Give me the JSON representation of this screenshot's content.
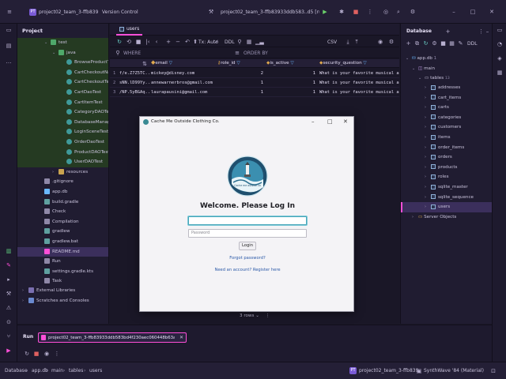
{
  "titlebar": {
    "project_badge": "PT",
    "project_name": "project02_team_3-ffb839",
    "vcs": "Version Control",
    "run_config": "project02_team_3-ffb83933ddb583..d5 [run]"
  },
  "project_panel": {
    "title": "Project",
    "items": [
      {
        "label": "test",
        "indent": 0
      },
      {
        "label": "java",
        "indent": 1
      },
      {
        "label": "BrowseProductTest",
        "indent": 2
      },
      {
        "label": "CartCheckoutNavi",
        "indent": 2
      },
      {
        "label": "CartCheckoutTest",
        "indent": 2
      },
      {
        "label": "CartDaoTest",
        "indent": 2
      },
      {
        "label": "CartItemTest",
        "indent": 2
      },
      {
        "label": "CategoryDAOTest",
        "indent": 2
      },
      {
        "label": "DatabaseManager",
        "indent": 2
      },
      {
        "label": "LoginSceneTest",
        "indent": 2
      },
      {
        "label": "OrderDaoTest",
        "indent": 2
      },
      {
        "label": "ProductDAOTest",
        "indent": 2
      },
      {
        "label": "UserDAOTest",
        "indent": 2
      },
      {
        "label": "resources",
        "indent": 1
      },
      {
        "label": ".gitignore",
        "indent": -1
      },
      {
        "label": "app.db",
        "indent": -1
      },
      {
        "label": "build.gradle",
        "indent": -1
      },
      {
        "label": "Check",
        "indent": -1
      },
      {
        "label": "Compilation",
        "indent": -1
      },
      {
        "label": "gradlew",
        "indent": -1
      },
      {
        "label": "gradlew.bat",
        "indent": -1
      },
      {
        "label": "README.md",
        "indent": -1
      },
      {
        "label": "Run",
        "indent": -1
      },
      {
        "label": "settings.gradle.kts",
        "indent": -1
      },
      {
        "label": "Task",
        "indent": -1
      }
    ],
    "external": "External Libraries",
    "scratches": "Scratches and Consoles"
  },
  "editor": {
    "tab": "users",
    "toolbar": {
      "tx": "Tx: Auto",
      "ddl": "DDL",
      "csv": "CSV"
    },
    "where": "WHERE",
    "order_by": "ORDER BY",
    "columns": [
      "email",
      "role_id",
      "is_active",
      "security_question"
    ],
    "rows": [
      {
        "n": "1",
        "id": "f/e.Z7Z5TC...",
        "email": "mickey@disney.com",
        "role": "2",
        "active": "1",
        "q": "What is your favorite musical a"
      },
      {
        "n": "2",
        "id": "sNN.lD99Yy...",
        "email": "annewarnerbros@gmail.com",
        "role": "1",
        "active": "1",
        "q": "What is your favorite musical a"
      },
      {
        "n": "3",
        "id": "/NP.5yBGAq...",
        "email": "laurapausini@gmail.com",
        "role": "1",
        "active": "1",
        "q": "What is your favorite musical a"
      }
    ],
    "rows_count": "3 rows"
  },
  "dialog": {
    "title": "Cache Me Outside Clothing Co.",
    "logo_text": "Cache me outside co",
    "heading": "Welcome. Please Log In",
    "email_placeholder": "",
    "password_placeholder": "Password",
    "login_button": "Login",
    "forgot": "Forgot password?",
    "register": "Need an account? Register here"
  },
  "db_panel": {
    "title": "Database",
    "ddl": "DDL",
    "app_db": "app.db",
    "count": "1",
    "main": "main",
    "tables_label": "tables",
    "tables_count": "13",
    "tables": [
      "addresses",
      "cart_items",
      "carts",
      "categories",
      "customers",
      "items",
      "order_items",
      "orders",
      "products",
      "roles",
      "sqlite_master",
      "sqlite_sequence",
      "users"
    ],
    "server_objects": "Server Objects"
  },
  "run_panel": {
    "label": "Run",
    "tab": "project02_team_3-ffb83933ddb583bd4f230aec060448b63a33..."
  },
  "statusbar": {
    "crumbs": [
      "Database",
      "app.db",
      "main",
      "tables",
      "users"
    ],
    "project_badge": "PT",
    "project": "project02_team_3-ffb839",
    "theme": "SynthWave '84 (Material)"
  },
  "colors": {
    "accent": "#ff4fd8",
    "selection": "#3b2f5c",
    "green": "#253a22"
  }
}
